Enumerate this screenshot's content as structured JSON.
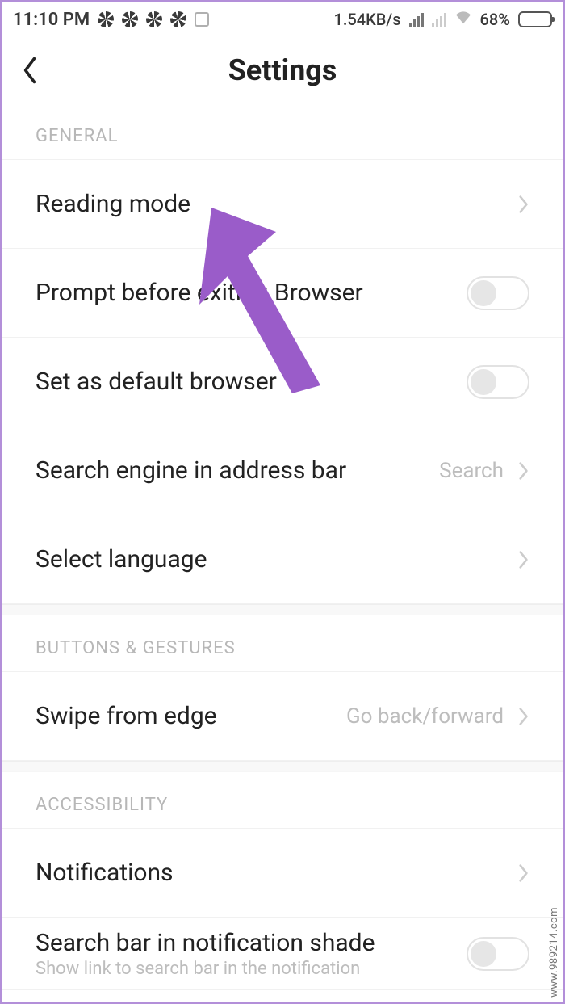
{
  "status": {
    "time": "11:10 PM",
    "data_rate": "1.54KB/s",
    "battery_pct": "68%"
  },
  "header": {
    "title": "Settings"
  },
  "sections": {
    "general": {
      "header": "GENERAL",
      "reading_mode": "Reading mode",
      "prompt_exit": "Prompt before exiting Browser",
      "default_browser": "Set as default browser",
      "search_engine_label": "Search engine in address bar",
      "search_engine_value": "Search",
      "select_language": "Select language"
    },
    "buttons_gestures": {
      "header": "BUTTONS & GESTURES",
      "swipe_label": "Swipe from edge",
      "swipe_value": "Go back/forward"
    },
    "accessibility": {
      "header": "ACCESSIBILITY",
      "notifications": "Notifications",
      "search_bar_label": "Search bar in notification shade",
      "search_bar_sub": "Show link to search bar in the notification"
    }
  },
  "watermark": "www.989214.com"
}
